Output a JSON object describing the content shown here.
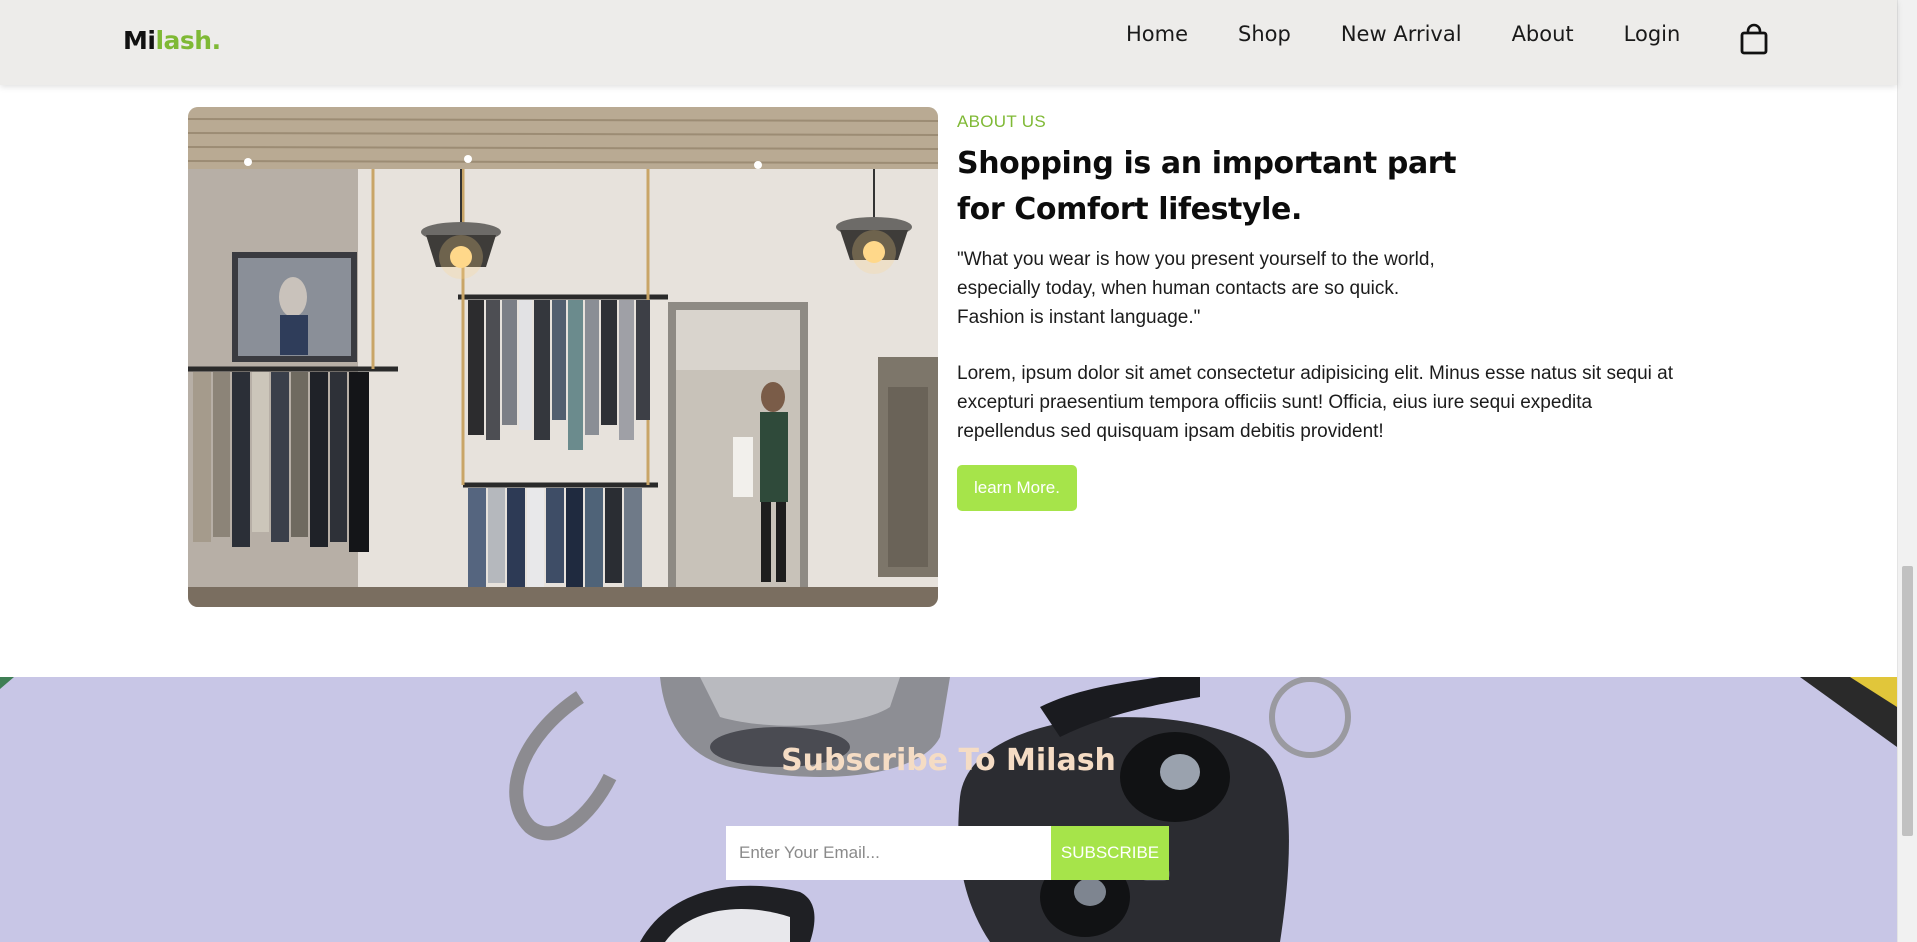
{
  "header": {
    "logo_part1": "Mi",
    "logo_part2": "lash.",
    "nav": [
      "Home",
      "Shop",
      "New Arrival",
      "About",
      "Login"
    ],
    "cart_icon": "shopping-bag-icon"
  },
  "about": {
    "eyebrow": "ABOUT US",
    "headline_line1": "Shopping is an important part",
    "headline_line2": "for Comfort lifestyle.",
    "quote_line1": "\"What you wear is how you present yourself to the world,",
    "quote_line2": "especially today, when human contacts are so quick.",
    "quote_line3": "Fashion is instant language.\"",
    "paragraph": "Lorem, ipsum dolor sit amet consectetur adipisicing elit. Minus esse natus sit sequi at excepturi praesentium tempora officiis sunt! Officia, eius iure sequi expedita repellendus sed quisquam ipsam debitis provident!",
    "button": "learn More."
  },
  "subscribe": {
    "title": "Subscribe To Milash",
    "email_placeholder": "Enter Your Email...",
    "button": "SUBSCRIBE"
  },
  "colors": {
    "brand_green": "#7fb935",
    "button_green": "#a6e44a",
    "subscribe_bg": "#c8c6e6",
    "subscribe_title": "#f5dcc4",
    "navbar_bg": "#edecea"
  }
}
